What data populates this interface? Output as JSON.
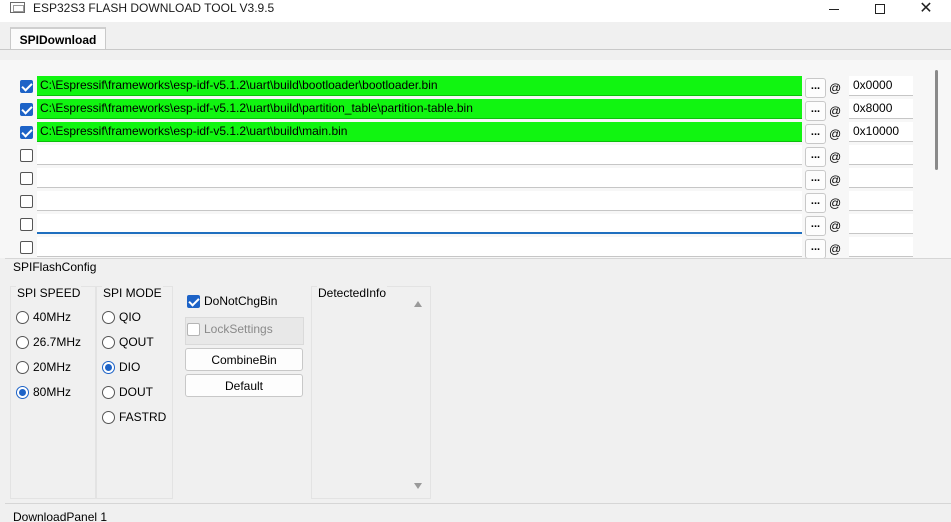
{
  "window": {
    "title": "ESP32S3 FLASH DOWNLOAD TOOL V3.9.5",
    "close_glyph": "✕"
  },
  "tabs": [
    {
      "label": "SPIDownload",
      "active": true
    }
  ],
  "file_rows": [
    {
      "checked": true,
      "path": "C:\\Espressif\\frameworks\\esp-idf-v5.1.2\\uart\\build\\bootloader\\bootloader.bin",
      "browse": "...",
      "at": "@",
      "address": "0x0000"
    },
    {
      "checked": true,
      "path": "C:\\Espressif\\frameworks\\esp-idf-v5.1.2\\uart\\build\\partition_table\\partition-table.bin",
      "browse": "...",
      "at": "@",
      "address": "0x8000"
    },
    {
      "checked": true,
      "path": "C:\\Espressif\\frameworks\\esp-idf-v5.1.2\\uart\\build\\main.bin",
      "browse": "...",
      "at": "@",
      "address": "0x10000"
    },
    {
      "checked": false,
      "path": "",
      "browse": "...",
      "at": "@",
      "address": ""
    },
    {
      "checked": false,
      "path": "",
      "browse": "...",
      "at": "@",
      "address": ""
    },
    {
      "checked": false,
      "path": "",
      "browse": "...",
      "at": "@",
      "address": ""
    },
    {
      "checked": false,
      "path": "",
      "browse": "...",
      "at": "@",
      "address": ""
    },
    {
      "checked": false,
      "path": "",
      "browse": "...",
      "at": "@",
      "address": ""
    }
  ],
  "spi_flash_config": {
    "title": "SPIFlashConfig",
    "spi_speed": {
      "title": "SPI SPEED",
      "options": [
        "40MHz",
        "26.7MHz",
        "20MHz",
        "80MHz"
      ],
      "selected": "80MHz"
    },
    "spi_mode": {
      "title": "SPI MODE",
      "options": [
        "QIO",
        "QOUT",
        "DIO",
        "DOUT",
        "FASTRD"
      ],
      "selected": "DIO"
    },
    "do_not_chg_bin": {
      "label": "DoNotChgBin",
      "checked": true
    },
    "lock_settings": {
      "label": "LockSettings",
      "checked": false,
      "enabled": false
    },
    "combine_bin_label": "CombineBin",
    "default_label": "Default",
    "detected_info": {
      "title": "DetectedInfo"
    }
  },
  "download_panel": {
    "title": "DownloadPanel 1"
  },
  "colors": {
    "loaded_path_bg": "#11f511",
    "accent": "#1d63c7"
  }
}
